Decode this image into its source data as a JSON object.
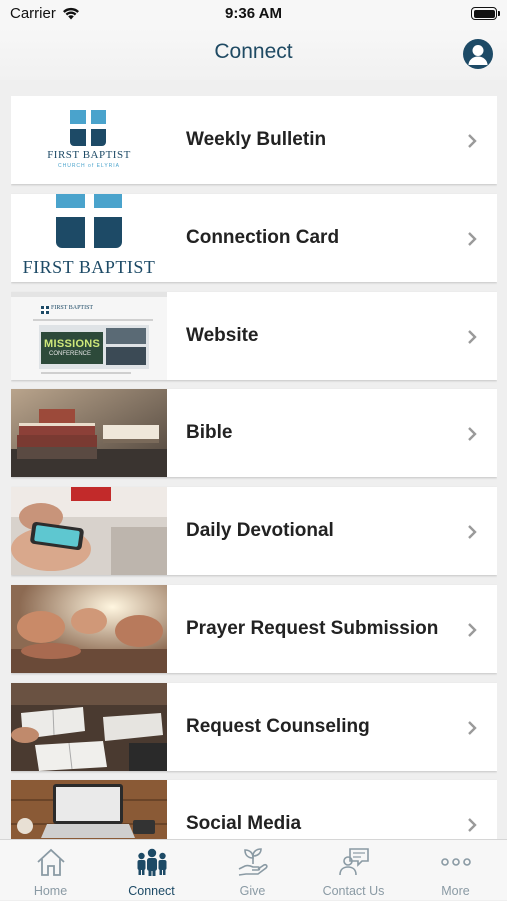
{
  "status_bar": {
    "carrier": "Carrier",
    "time": "9:36 AM"
  },
  "nav": {
    "title": "Connect",
    "profile_icon": "person-icon"
  },
  "list": {
    "items": [
      {
        "label": "Weekly Bulletin",
        "thumb": "first-baptist-logo-small",
        "logo_text": "FIRST BAPTIST",
        "logo_sub": "CHURCH of ELYRIA"
      },
      {
        "label": "Connection Card",
        "thumb": "first-baptist-logo-large",
        "logo_text": "FIRST BAPTIST"
      },
      {
        "label": "Website",
        "thumb": "website-screenshot",
        "site_title": "FIRST BAPTIST",
        "banner_text": "MISSIONS",
        "banner_sub": "CONFERENCE"
      },
      {
        "label": "Bible",
        "thumb": "books-photo"
      },
      {
        "label": "Daily Devotional",
        "thumb": "phone-photo"
      },
      {
        "label": "Prayer Request Submission",
        "thumb": "praying-hands-photo"
      },
      {
        "label": "Request Counseling",
        "thumb": "open-bibles-photo"
      },
      {
        "label": "Social Media",
        "thumb": "laptop-photo"
      }
    ]
  },
  "tabs": [
    {
      "label": "Home",
      "icon": "home-icon",
      "active": false
    },
    {
      "label": "Connect",
      "icon": "people-icon",
      "active": true
    },
    {
      "label": "Give",
      "icon": "hand-plant-icon",
      "active": false
    },
    {
      "label": "Contact Us",
      "icon": "contact-chat-icon",
      "active": false
    },
    {
      "label": "More",
      "icon": "more-dots-icon",
      "active": false
    }
  ],
  "colors": {
    "brand": "#1d4a66",
    "logo_blue": "#4aa3cc",
    "tab_inactive": "#8a9aa4",
    "background": "#efefef"
  }
}
